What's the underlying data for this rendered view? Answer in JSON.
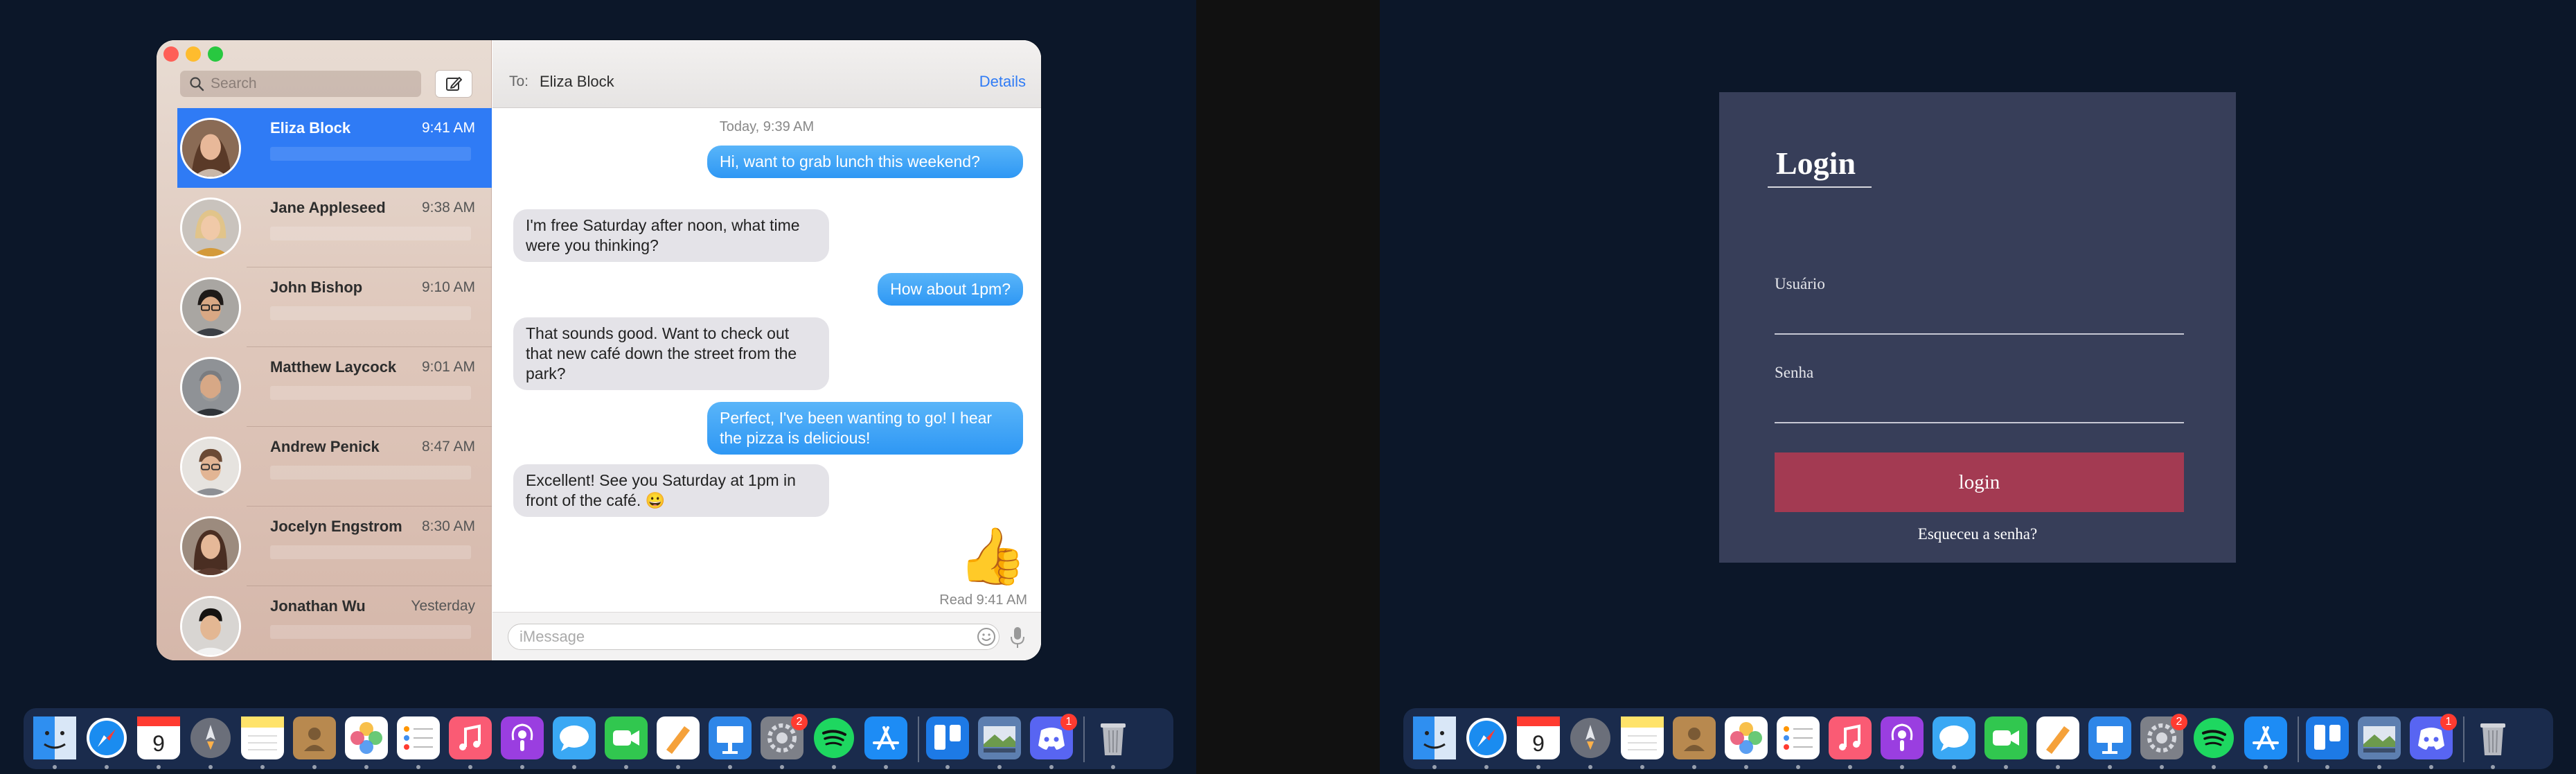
{
  "messages": {
    "search_placeholder": "Search",
    "to_label": "To:",
    "recipient": "Eliza Block",
    "details_label": "Details",
    "day_stamp": "Today, 9:39 AM",
    "conversations": [
      {
        "name": "Eliza Block",
        "time": "9:41 AM",
        "active": true
      },
      {
        "name": "Jane Appleseed",
        "time": "9:38 AM"
      },
      {
        "name": "John Bishop",
        "time": "9:10 AM"
      },
      {
        "name": "Matthew Laycock",
        "time": "9:01 AM"
      },
      {
        "name": "Andrew Penick",
        "time": "8:47 AM"
      },
      {
        "name": "Jocelyn Engstrom",
        "time": "8:30 AM"
      },
      {
        "name": "Jonathan Wu",
        "time": "Yesterday"
      }
    ],
    "thread": [
      {
        "from": "me",
        "text": "Hi, want to grab lunch this weekend?"
      },
      {
        "from": "them",
        "text": "I'm free Saturday after noon, what time were you thinking?"
      },
      {
        "from": "me",
        "text": "How about 1pm?"
      },
      {
        "from": "them",
        "text": "That sounds good. Want to check out that new café down the street from the park?"
      },
      {
        "from": "me",
        "text": "Perfect, I've been wanting to go! I hear the pizza is delicious!"
      },
      {
        "from": "them",
        "text": "Excellent! See you Saturday at 1pm in front of the café. 😀"
      }
    ],
    "thumbs_up": "👍",
    "read_receipt": "Read 9:41 AM",
    "input_placeholder": "iMessage"
  },
  "login": {
    "title": "Login",
    "username_label": "Usuário",
    "password_label": "Senha",
    "button_label": "login",
    "forgot_label": "Esqueceu a senha?"
  },
  "dock": {
    "apps": [
      {
        "name": "finder-icon",
        "color": "#2f8ff0"
      },
      {
        "name": "safari-icon",
        "color": "#1a8cf0"
      },
      {
        "name": "calendar-icon",
        "color": "#ffffff",
        "text": "9"
      },
      {
        "name": "launchpad-icon",
        "color": "#6b6f7a"
      },
      {
        "name": "notes-icon",
        "color": "#ffe36a"
      },
      {
        "name": "contacts-icon",
        "color": "#b8894f"
      },
      {
        "name": "photos-icon",
        "color": "#f2b7c4"
      },
      {
        "name": "reminders-icon",
        "color": "#ffffff"
      },
      {
        "name": "music-icon",
        "color": "#fa5b74"
      },
      {
        "name": "podcasts-icon",
        "color": "#9a3ee0"
      },
      {
        "name": "messages-icon",
        "color": "#3aa8f4"
      },
      {
        "name": "facetime-icon",
        "color": "#31c74f"
      },
      {
        "name": "pages-icon",
        "color": "#f5a13a"
      },
      {
        "name": "keynote-icon",
        "color": "#2e86e8"
      },
      {
        "name": "system-preferences-icon",
        "color": "#7d8088",
        "badge": "2"
      },
      {
        "name": "spotify-icon",
        "color": "#1ed760"
      },
      {
        "name": "app-store-icon",
        "color": "#1d8cf5"
      },
      {
        "name": "trello-icon",
        "color": "#1d7ae6"
      },
      {
        "name": "image-capture-icon",
        "color": "#5d7fb0"
      },
      {
        "name": "discord-icon",
        "color": "#5865f2",
        "badge": "1"
      },
      {
        "name": "trash-icon",
        "color": "#8d9099"
      }
    ]
  }
}
